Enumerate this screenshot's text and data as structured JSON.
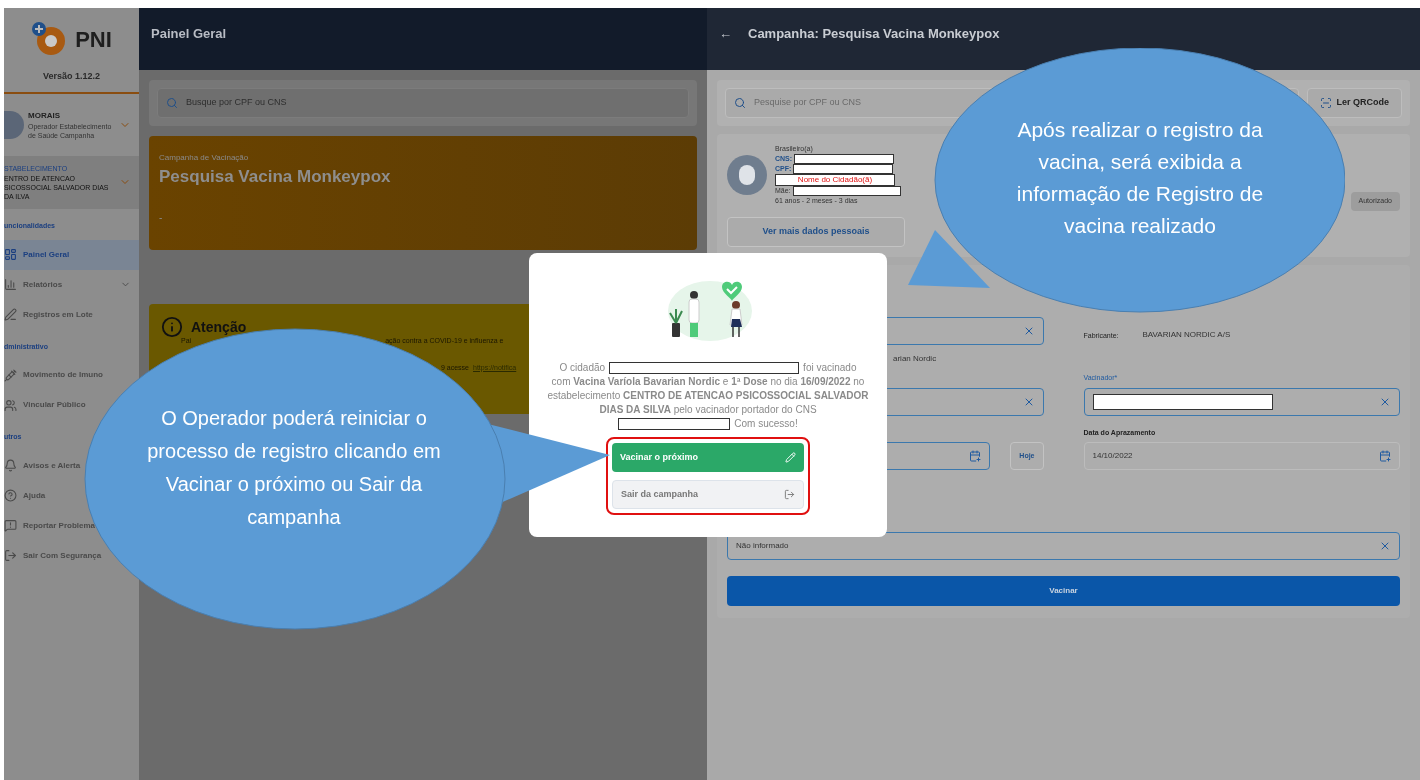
{
  "sidebar": {
    "logo_text": "PNI",
    "version": "Versão 1.12.2",
    "user": {
      "name": "MORAIS",
      "role": "Operador Estabelecimento de Saúde Campanha",
      "expanded": false
    },
    "establishment": {
      "label": "STABELECIMENTO",
      "name": "ENTRO DE ATENCAO SICOSSOCIAL SALVADOR DIAS DA ILVA"
    },
    "sections": [
      {
        "title": "uncionalidades",
        "items": [
          {
            "label": "Painel Geral",
            "selected": true,
            "expandable": false
          },
          {
            "label": "Relatórios",
            "selected": false,
            "expandable": true
          },
          {
            "label": "Registros em Lote",
            "selected": false,
            "expandable": false
          }
        ]
      },
      {
        "title": "dministrativo",
        "items": [
          {
            "label": "Movimento de Imuno",
            "selected": false,
            "expandable": false
          },
          {
            "label": "Vincular Público",
            "selected": false,
            "expandable": false
          }
        ]
      },
      {
        "title": "utros",
        "items": [
          {
            "label": "Avisos e Alerta",
            "selected": false,
            "expandable": false
          },
          {
            "label": "Ajuda",
            "selected": false,
            "expandable": false
          },
          {
            "label": "Reportar Problema",
            "selected": false,
            "expandable": false
          },
          {
            "label": "Sair Com Segurança",
            "selected": false,
            "expandable": false
          }
        ]
      }
    ]
  },
  "main": {
    "title": "Painel Geral",
    "search": {
      "placeholder": "Busque por CPF ou CNS"
    },
    "campaign_card": {
      "label": "Campanha de Vacinação",
      "title": "Pesquisa Vacina Monkeypox",
      "note": "-"
    },
    "alert": {
      "title": "Atenção",
      "fragments": [
        "Pai",
        "ação contra a COVID-19 e influenza e",
        "9 acesse"
      ],
      "link": "https://notifica"
    }
  },
  "panel": {
    "title": "Campanha: Pesquisa Vacina Monkeypox",
    "back": "←",
    "search": {
      "placeholder": "Pesquise por CPF ou CNS"
    },
    "qr_button": "Ler QRCode",
    "citizen": {
      "nationality": "Brasileiro(a)",
      "cns_label": "CNS:",
      "cpf_label": "CPF:",
      "name": "Nome do Cidadão(ã)",
      "mother_label": "Mãe:",
      "age": "61 anos - 2 meses - 3 dias",
      "more_button": "Ver mais dados pessoais",
      "status": "Autorizado"
    },
    "form": {
      "vaccine_fragment": "arian Nordic",
      "manufacturer_label": "Fabricante:",
      "manufacturer": "BAVARIAN NORDIC A/S",
      "vaccinator_label": "Vacinador*",
      "today_button": "Hoje",
      "schedule_label": "Data do Aprazamento",
      "schedule_value": "14/10/2022",
      "last_value": "Não informado",
      "submit": "Vacinar"
    }
  },
  "modal": {
    "message": {
      "lead": "O cidadão",
      "lead_end": "foi vacinado",
      "body": "com **Vacina Varíola Bavarian Nordic** e **1ª Dose** no dia **16/09/2022** no estabelecimento **CENTRO DE ATENCAO PSICOSSOCIAL SALVADOR DIAS DA SILVA** pelo vacinador portador do CNS",
      "closing": "Com sucesso!"
    },
    "buttons": [
      {
        "label": "Vacinar o próximo",
        "kind": "primary"
      },
      {
        "label": "Sair da campanha",
        "kind": "secondary"
      }
    ]
  },
  "callouts": [
    {
      "text": "Após realizar o registro da vacina, será exibida a informação de Registro de vacina realizado"
    },
    {
      "text": "O Operador poderá reiniciar o processo de registro clicando em Vacinar o próximo ou Sair da campanha"
    }
  ]
}
